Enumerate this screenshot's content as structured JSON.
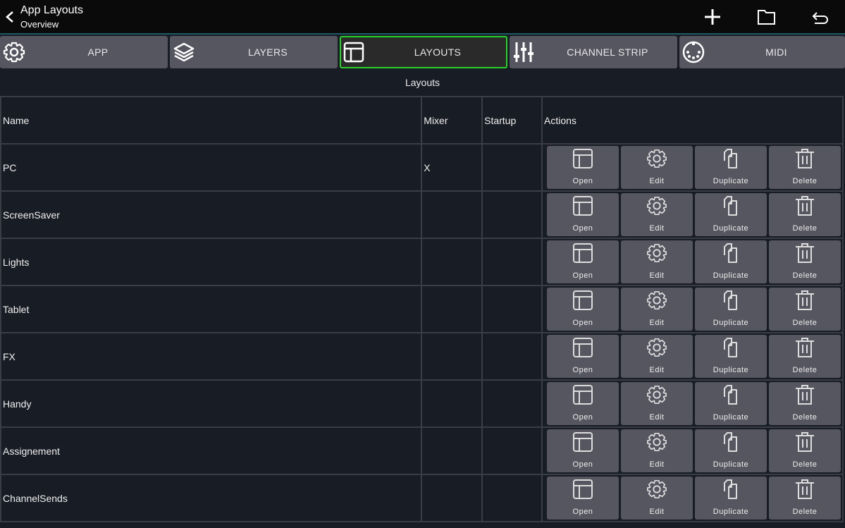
{
  "header": {
    "title": "App Layouts",
    "subtitle": "Overview",
    "icons": [
      "back-icon",
      "add-icon",
      "folder-icon",
      "undo-icon"
    ]
  },
  "tabs": [
    {
      "label": "APP",
      "icon": "gear-icon",
      "active": false
    },
    {
      "label": "LAYERS",
      "icon": "layers-icon",
      "active": false
    },
    {
      "label": "LAYOUTS",
      "icon": "layout-icon",
      "active": true
    },
    {
      "label": "CHANNEL STRIP",
      "icon": "sliders-icon",
      "active": false
    },
    {
      "label": "MIDI",
      "icon": "midi-icon",
      "active": false
    }
  ],
  "section_title": "Layouts",
  "table": {
    "columns": [
      "Name",
      "Mixer",
      "Startup",
      "Actions"
    ],
    "rows": [
      {
        "name": "PC",
        "mixer": "X",
        "startup": ""
      },
      {
        "name": "ScreenSaver",
        "mixer": "",
        "startup": ""
      },
      {
        "name": "Lights",
        "mixer": "",
        "startup": ""
      },
      {
        "name": "Tablet",
        "mixer": "",
        "startup": ""
      },
      {
        "name": "FX",
        "mixer": "",
        "startup": ""
      },
      {
        "name": "Handy",
        "mixer": "",
        "startup": ""
      },
      {
        "name": "Assignement",
        "mixer": "",
        "startup": ""
      },
      {
        "name": "ChannelSends",
        "mixer": "",
        "startup": ""
      }
    ],
    "actions": [
      {
        "label": "Open",
        "icon": "layout-icon"
      },
      {
        "label": "Edit",
        "icon": "gear-icon"
      },
      {
        "label": "Duplicate",
        "icon": "duplicate-icon"
      },
      {
        "label": "Delete",
        "icon": "trash-icon"
      }
    ]
  },
  "colors": {
    "active_tab_border": "#27d327",
    "tab_bg": "#565661",
    "header_accent": "#1d5a66"
  }
}
